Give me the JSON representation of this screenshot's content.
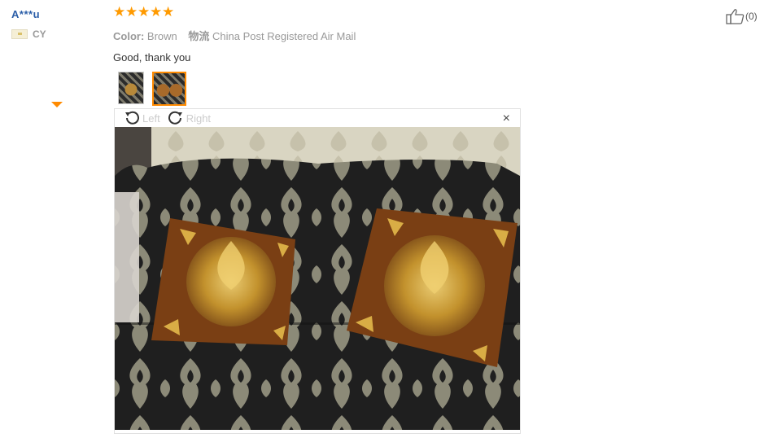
{
  "reviewer": {
    "name": "A***u",
    "country_code": "CY"
  },
  "review": {
    "rating": 5,
    "color_label": "Color:",
    "color_value": "Brown",
    "shipping_label": "物流",
    "shipping_value": "China Post Registered Air Mail",
    "text": "Good, thank you"
  },
  "thumbnails": [
    "photo-1",
    "photo-2"
  ],
  "viewer": {
    "rotate_left_label": "Left",
    "rotate_right_label": "Right",
    "close_symbol": "×",
    "icons": [
      "rotate-left-icon",
      "rotate-right-icon",
      "close-icon"
    ]
  },
  "helpful": {
    "count_text": "(0)",
    "icon": "thumbs-up-icon"
  },
  "colors": {
    "star": "#ff9a00",
    "accent": "#ff8a00",
    "username": "#2b5ea8"
  }
}
